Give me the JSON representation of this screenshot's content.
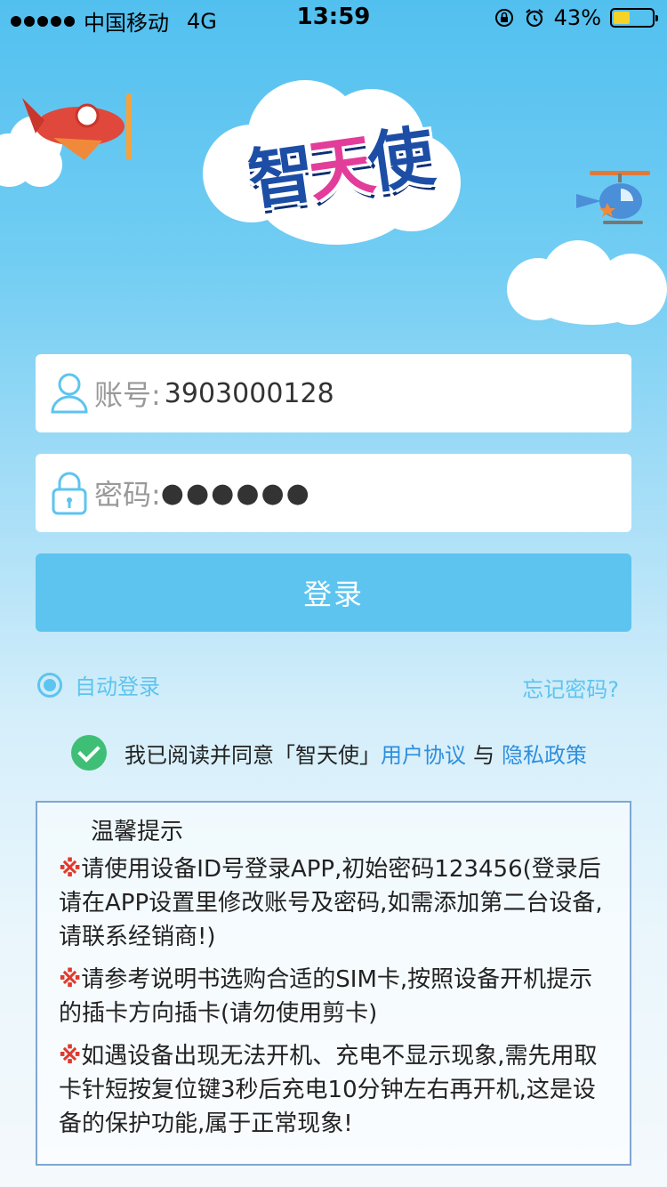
{
  "status_bar": {
    "carrier": "中国移动",
    "network": "4G",
    "time": "13:59",
    "battery_text": "43%",
    "battery_level": 0.43
  },
  "logo": {
    "part1": "智",
    "part2": "天",
    "part3": "使"
  },
  "account": {
    "label": "账号:",
    "value": "3903000128"
  },
  "password": {
    "label": "密码:",
    "masked": "●●●●●●"
  },
  "login_button": "登录",
  "auto_login": "自动登录",
  "forgot_password": "忘记密码?",
  "agreement": {
    "prefix": "我已阅读并同意「智天使」",
    "user_agreement": "用户协议",
    "conjunction": "与",
    "privacy_policy": "隐私政策"
  },
  "tips": {
    "title": "温馨提示",
    "mark": "※",
    "items": [
      "请使用设备ID号登录APP,初始密码123456(登录后请在APP设置里修改账号及密码,如需添加第二台设备,请联系经销商!)",
      "请参考说明书选购合适的SIM卡,按照设备开机提示的插卡方向插卡(请勿使用剪卡)",
      "如遇设备出现无法开机、充电不显示现象,需先用取卡针短按复位键3秒后充电10分钟左右再开机,这是设备的保护功能,属于正常现象!"
    ]
  },
  "colors": {
    "accent": "#5dc4ef",
    "link": "#2f8fdd",
    "check_green": "#3fbf75",
    "warning_red": "#e0392c",
    "tip_border": "#7fa6d2"
  },
  "icons": [
    "user-icon",
    "lock-icon",
    "plane-icon",
    "helicopter-icon",
    "cloud-icon",
    "check-icon",
    "radio-icon",
    "battery-icon",
    "alarm-icon",
    "rotation-lock-icon"
  ]
}
